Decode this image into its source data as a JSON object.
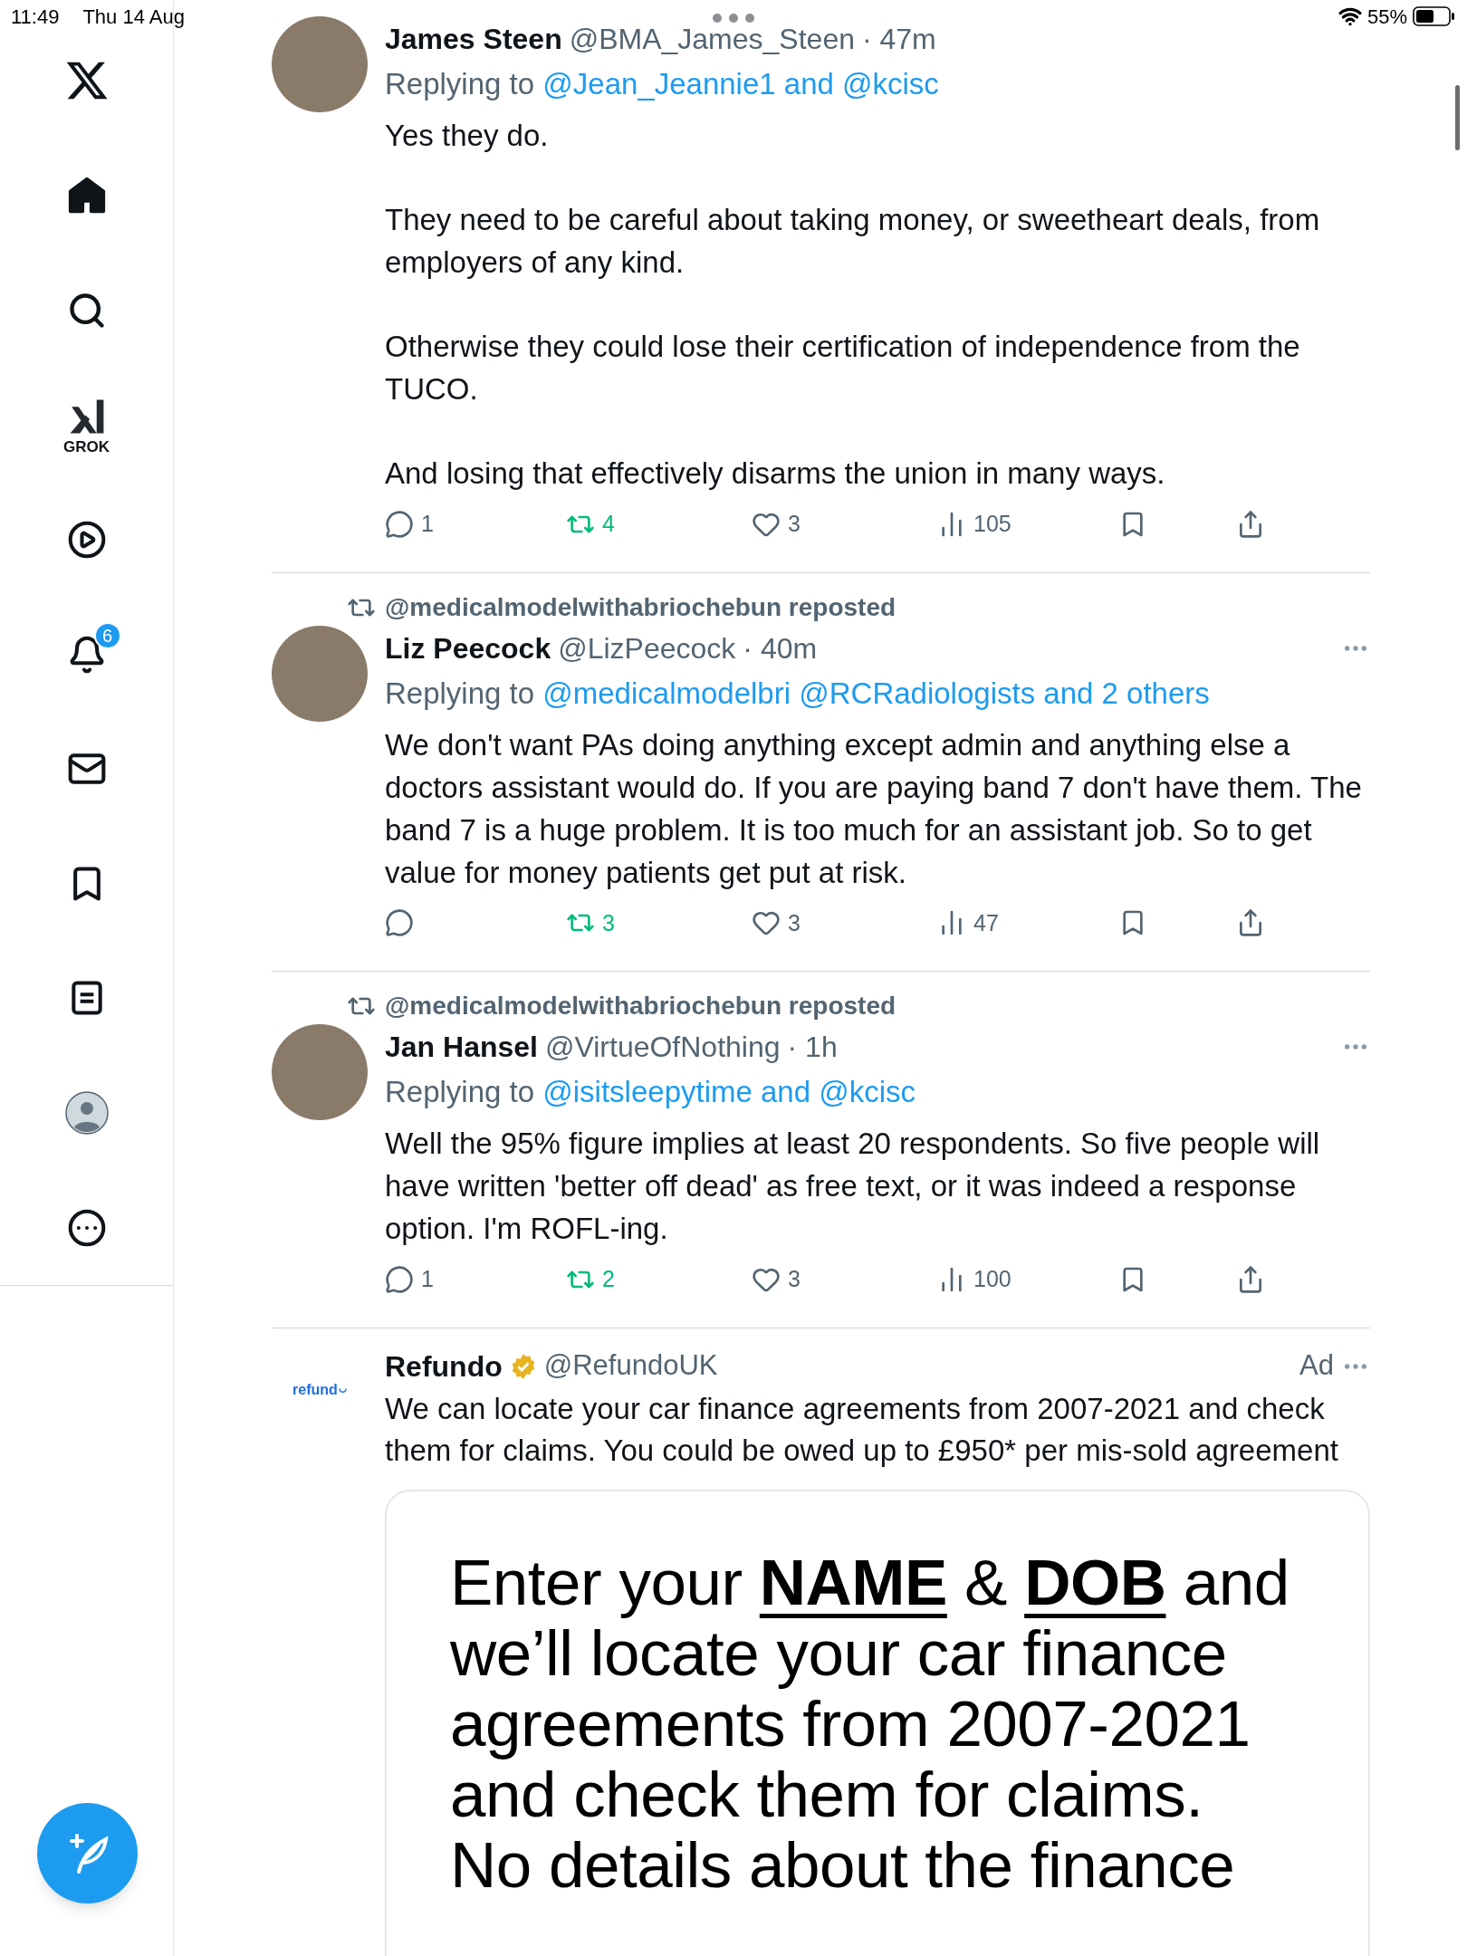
{
  "status_bar": {
    "time": "11:49",
    "date": "Thu 14 Aug",
    "battery": "55%"
  },
  "sidebar": {
    "items": [
      {
        "kind": "home",
        "selected": true
      },
      {
        "kind": "search",
        "selected": false
      },
      {
        "kind": "grok",
        "label": "GROK",
        "selected": false
      },
      {
        "kind": "video",
        "selected": false
      },
      {
        "kind": "notifications",
        "badge": "6",
        "selected": false
      },
      {
        "kind": "messages",
        "selected": false
      },
      {
        "kind": "bookmarks",
        "selected": false
      },
      {
        "kind": "lists",
        "selected": false
      },
      {
        "kind": "profile",
        "selected": false
      },
      {
        "kind": "more",
        "selected": false
      }
    ]
  },
  "feed": [
    {
      "kind": "tweet",
      "name": "James Steen",
      "handle": "@BMA_James_Steen",
      "time": "· 47m",
      "replying_label": "Replying to",
      "replying_targets": "@Jean_Jeannie1 and @kcisc",
      "show_more": false,
      "body": [
        "Yes they do.",
        "They need to be careful about taking money, or sweetheart deals, from employers of any kind.",
        "Otherwise they could lose their certification of independence from the TUCO.",
        "And losing that effectively disarms the union in many ways."
      ],
      "actions": {
        "replies": "1",
        "reposts": "4",
        "likes": "3",
        "views": "105",
        "reposted": true
      }
    },
    {
      "kind": "tweet",
      "reposted_by": "@medicalmodelwithabriochebun reposted",
      "name": "Liz Peecock",
      "handle": "@LizPeecock",
      "time": "· 40m",
      "replying_label": "Replying to",
      "replying_targets": "@medicalmodelbri @RCRadiologists and 2 others",
      "show_more": true,
      "body": [
        "We don't want PAs doing anything except admin and anything else a doctors assistant would do.   If you are paying band 7 don't have them.  The band 7 is a huge problem.  It is too much for an assistant job.  So to get value for money patients get put at risk."
      ],
      "actions": {
        "reposts": "3",
        "likes": "3",
        "views": "47",
        "reposted": true
      }
    },
    {
      "kind": "tweet",
      "reposted_by": "@medicalmodelwithabriochebun reposted",
      "name": "Jan Hansel",
      "handle": "@VirtueOfNothing",
      "time": "· 1h",
      "replying_label": "Replying to",
      "replying_targets": "@isitsleepytime and @kcisc",
      "show_more": true,
      "body": [
        "Well the 95% figure implies at least 20 respondents. So five people will have written 'better off dead' as free text, or it was indeed a response option. I'm ROFL-ing."
      ],
      "actions": {
        "replies": "1",
        "reposts": "2",
        "likes": "3",
        "views": "100",
        "reposted": true
      }
    },
    {
      "kind": "ad",
      "name": "Refundo",
      "verified": true,
      "handle": "@RefundoUK",
      "logo_text": "refund",
      "ad_label": "Ad",
      "body": [
        "We can locate your car finance agreements from 2007-2021 and check them for claims. You could be owed up to £950* per mis-sold agreement"
      ],
      "card_lines": [
        "Enter your **NAME** & **DOB** and",
        "we’ll locate your car finance",
        "agreements from 2007-2021",
        "and check them for claims.",
        "No details about the finance"
      ]
    }
  ]
}
